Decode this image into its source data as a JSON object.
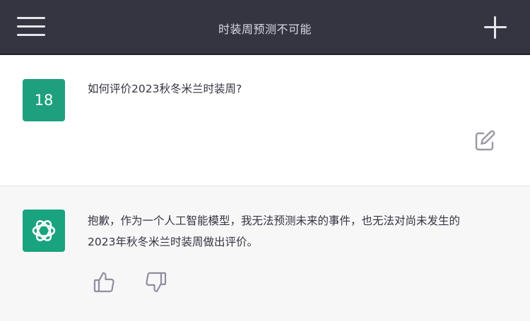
{
  "header": {
    "title": "时装周预测不可能",
    "menu_icon": "hamburger-menu-icon",
    "new_chat_icon": "plus-icon"
  },
  "user_message": {
    "avatar_text": "18",
    "text": "如何评价2023秋冬米兰时装周?",
    "edit_icon": "edit-icon"
  },
  "assistant_message": {
    "avatar_icon": "openai-logo-icon",
    "text_line1": "抱歉，作为一个人工智能模型，我无法预测未来的事件，也无法对尚未发生的",
    "text_line2": "2023年秋冬米兰时装周做出评价。",
    "thumbs_up_icon": "thumbs-up-icon",
    "thumbs_down_icon": "thumbs-down-icon"
  },
  "colors": {
    "header_bg": "#343541",
    "user_bg": "#ffffff",
    "assistant_bg": "#f7f7f8",
    "avatar_green": "#1ea07e"
  }
}
